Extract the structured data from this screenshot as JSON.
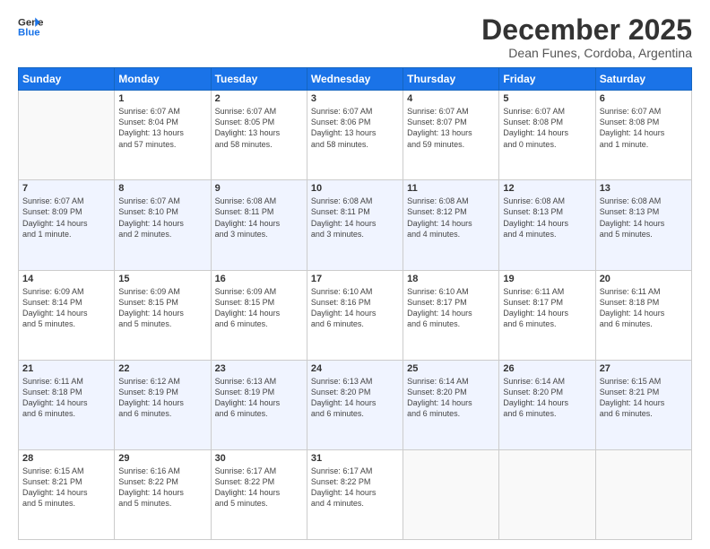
{
  "header": {
    "logo_line1": "General",
    "logo_line2": "Blue",
    "title": "December 2025",
    "subtitle": "Dean Funes, Cordoba, Argentina"
  },
  "days_of_week": [
    "Sunday",
    "Monday",
    "Tuesday",
    "Wednesday",
    "Thursday",
    "Friday",
    "Saturday"
  ],
  "weeks": [
    [
      {
        "day": "",
        "lines": []
      },
      {
        "day": "1",
        "lines": [
          "Sunrise: 6:07 AM",
          "Sunset: 8:04 PM",
          "Daylight: 13 hours",
          "and 57 minutes."
        ]
      },
      {
        "day": "2",
        "lines": [
          "Sunrise: 6:07 AM",
          "Sunset: 8:05 PM",
          "Daylight: 13 hours",
          "and 58 minutes."
        ]
      },
      {
        "day": "3",
        "lines": [
          "Sunrise: 6:07 AM",
          "Sunset: 8:06 PM",
          "Daylight: 13 hours",
          "and 58 minutes."
        ]
      },
      {
        "day": "4",
        "lines": [
          "Sunrise: 6:07 AM",
          "Sunset: 8:07 PM",
          "Daylight: 13 hours",
          "and 59 minutes."
        ]
      },
      {
        "day": "5",
        "lines": [
          "Sunrise: 6:07 AM",
          "Sunset: 8:08 PM",
          "Daylight: 14 hours",
          "and 0 minutes."
        ]
      },
      {
        "day": "6",
        "lines": [
          "Sunrise: 6:07 AM",
          "Sunset: 8:08 PM",
          "Daylight: 14 hours",
          "and 1 minute."
        ]
      }
    ],
    [
      {
        "day": "7",
        "lines": [
          "Sunrise: 6:07 AM",
          "Sunset: 8:09 PM",
          "Daylight: 14 hours",
          "and 1 minute."
        ]
      },
      {
        "day": "8",
        "lines": [
          "Sunrise: 6:07 AM",
          "Sunset: 8:10 PM",
          "Daylight: 14 hours",
          "and 2 minutes."
        ]
      },
      {
        "day": "9",
        "lines": [
          "Sunrise: 6:08 AM",
          "Sunset: 8:11 PM",
          "Daylight: 14 hours",
          "and 3 minutes."
        ]
      },
      {
        "day": "10",
        "lines": [
          "Sunrise: 6:08 AM",
          "Sunset: 8:11 PM",
          "Daylight: 14 hours",
          "and 3 minutes."
        ]
      },
      {
        "day": "11",
        "lines": [
          "Sunrise: 6:08 AM",
          "Sunset: 8:12 PM",
          "Daylight: 14 hours",
          "and 4 minutes."
        ]
      },
      {
        "day": "12",
        "lines": [
          "Sunrise: 6:08 AM",
          "Sunset: 8:13 PM",
          "Daylight: 14 hours",
          "and 4 minutes."
        ]
      },
      {
        "day": "13",
        "lines": [
          "Sunrise: 6:08 AM",
          "Sunset: 8:13 PM",
          "Daylight: 14 hours",
          "and 5 minutes."
        ]
      }
    ],
    [
      {
        "day": "14",
        "lines": [
          "Sunrise: 6:09 AM",
          "Sunset: 8:14 PM",
          "Daylight: 14 hours",
          "and 5 minutes."
        ]
      },
      {
        "day": "15",
        "lines": [
          "Sunrise: 6:09 AM",
          "Sunset: 8:15 PM",
          "Daylight: 14 hours",
          "and 5 minutes."
        ]
      },
      {
        "day": "16",
        "lines": [
          "Sunrise: 6:09 AM",
          "Sunset: 8:15 PM",
          "Daylight: 14 hours",
          "and 6 minutes."
        ]
      },
      {
        "day": "17",
        "lines": [
          "Sunrise: 6:10 AM",
          "Sunset: 8:16 PM",
          "Daylight: 14 hours",
          "and 6 minutes."
        ]
      },
      {
        "day": "18",
        "lines": [
          "Sunrise: 6:10 AM",
          "Sunset: 8:17 PM",
          "Daylight: 14 hours",
          "and 6 minutes."
        ]
      },
      {
        "day": "19",
        "lines": [
          "Sunrise: 6:11 AM",
          "Sunset: 8:17 PM",
          "Daylight: 14 hours",
          "and 6 minutes."
        ]
      },
      {
        "day": "20",
        "lines": [
          "Sunrise: 6:11 AM",
          "Sunset: 8:18 PM",
          "Daylight: 14 hours",
          "and 6 minutes."
        ]
      }
    ],
    [
      {
        "day": "21",
        "lines": [
          "Sunrise: 6:11 AM",
          "Sunset: 8:18 PM",
          "Daylight: 14 hours",
          "and 6 minutes."
        ]
      },
      {
        "day": "22",
        "lines": [
          "Sunrise: 6:12 AM",
          "Sunset: 8:19 PM",
          "Daylight: 14 hours",
          "and 6 minutes."
        ]
      },
      {
        "day": "23",
        "lines": [
          "Sunrise: 6:13 AM",
          "Sunset: 8:19 PM",
          "Daylight: 14 hours",
          "and 6 minutes."
        ]
      },
      {
        "day": "24",
        "lines": [
          "Sunrise: 6:13 AM",
          "Sunset: 8:20 PM",
          "Daylight: 14 hours",
          "and 6 minutes."
        ]
      },
      {
        "day": "25",
        "lines": [
          "Sunrise: 6:14 AM",
          "Sunset: 8:20 PM",
          "Daylight: 14 hours",
          "and 6 minutes."
        ]
      },
      {
        "day": "26",
        "lines": [
          "Sunrise: 6:14 AM",
          "Sunset: 8:20 PM",
          "Daylight: 14 hours",
          "and 6 minutes."
        ]
      },
      {
        "day": "27",
        "lines": [
          "Sunrise: 6:15 AM",
          "Sunset: 8:21 PM",
          "Daylight: 14 hours",
          "and 6 minutes."
        ]
      }
    ],
    [
      {
        "day": "28",
        "lines": [
          "Sunrise: 6:15 AM",
          "Sunset: 8:21 PM",
          "Daylight: 14 hours",
          "and 5 minutes."
        ]
      },
      {
        "day": "29",
        "lines": [
          "Sunrise: 6:16 AM",
          "Sunset: 8:22 PM",
          "Daylight: 14 hours",
          "and 5 minutes."
        ]
      },
      {
        "day": "30",
        "lines": [
          "Sunrise: 6:17 AM",
          "Sunset: 8:22 PM",
          "Daylight: 14 hours",
          "and 5 minutes."
        ]
      },
      {
        "day": "31",
        "lines": [
          "Sunrise: 6:17 AM",
          "Sunset: 8:22 PM",
          "Daylight: 14 hours",
          "and 4 minutes."
        ]
      },
      {
        "day": "",
        "lines": []
      },
      {
        "day": "",
        "lines": []
      },
      {
        "day": "",
        "lines": []
      }
    ]
  ]
}
